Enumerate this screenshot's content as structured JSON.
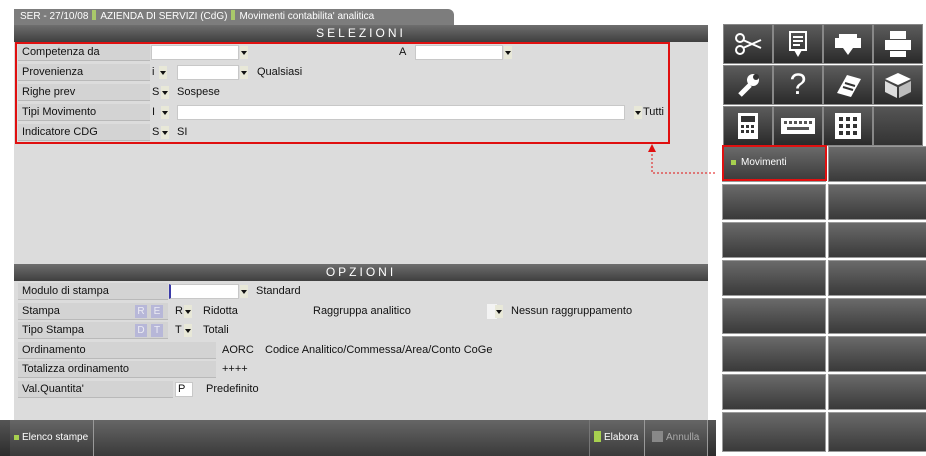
{
  "window": {
    "tab_company": "SER - 27/10/08",
    "tab_module": "AZIENDA DI SERVIZI (CdG)",
    "tab_program": "Movimenti contabilita' analitica"
  },
  "selezioni": {
    "title": "SELEZIONI",
    "competenza_label": "Competenza da",
    "competenza_a_label": "A",
    "provenienza_label": "Provenienza",
    "provenienza_code": "i",
    "provenienza_value": "Qualsiasi",
    "righe_label": "Righe prev",
    "righe_code": "S",
    "righe_value": "Sospese",
    "tipi_label": "Tipi Movimento",
    "tipi_code": "I",
    "tipi_value": "Tutti",
    "indicatore_label": "Indicatore CDG",
    "indicatore_code": "S",
    "indicatore_value": "SI"
  },
  "opzioni": {
    "title": "OPZIONI",
    "modulo_label": "Modulo di stampa",
    "modulo_value": "Standard",
    "stampa_label": "Stampa",
    "stampa_opt_r": "R",
    "stampa_opt_e": "E",
    "stampa_code": "R",
    "stampa_value": "Ridotta",
    "raggruppa_label": "Raggruppa analitico",
    "raggruppa_value": "Nessun raggruppamento",
    "tipo_label": "Tipo Stampa",
    "tipo_opt_d": "D",
    "tipo_opt_t": "T",
    "tipo_code": "T",
    "tipo_value": "Totali",
    "ordinamento_label": "Ordinamento",
    "ordinamento_code": "AORC",
    "ordinamento_value": "Codice Analitico/Commessa/Area/Conto CoGe",
    "totalizza_label": "Totalizza ordinamento",
    "totalizza_value": "++++",
    "valq_label": "Val.Quantita'",
    "valq_code": "P",
    "valq_value": "Predefinito"
  },
  "toolbar": {
    "icons": [
      "scissors-icon",
      "paste-icon",
      "printer-setup-icon",
      "printer-icon",
      "wrench-icon",
      "help-icon",
      "notes-icon",
      "box-icon",
      "calculator-icon",
      "keyboard-icon",
      "grid-icon"
    ],
    "help_glyph": "?"
  },
  "menu": {
    "movimenti_label": "Movimenti"
  },
  "bottom": {
    "elenco_label": "Elenco stampe",
    "elabora_label": "Elabora",
    "annulla_label": "Annulla"
  },
  "colors": {
    "highlight": "#e01010",
    "accent_green": "#a7d04f"
  }
}
